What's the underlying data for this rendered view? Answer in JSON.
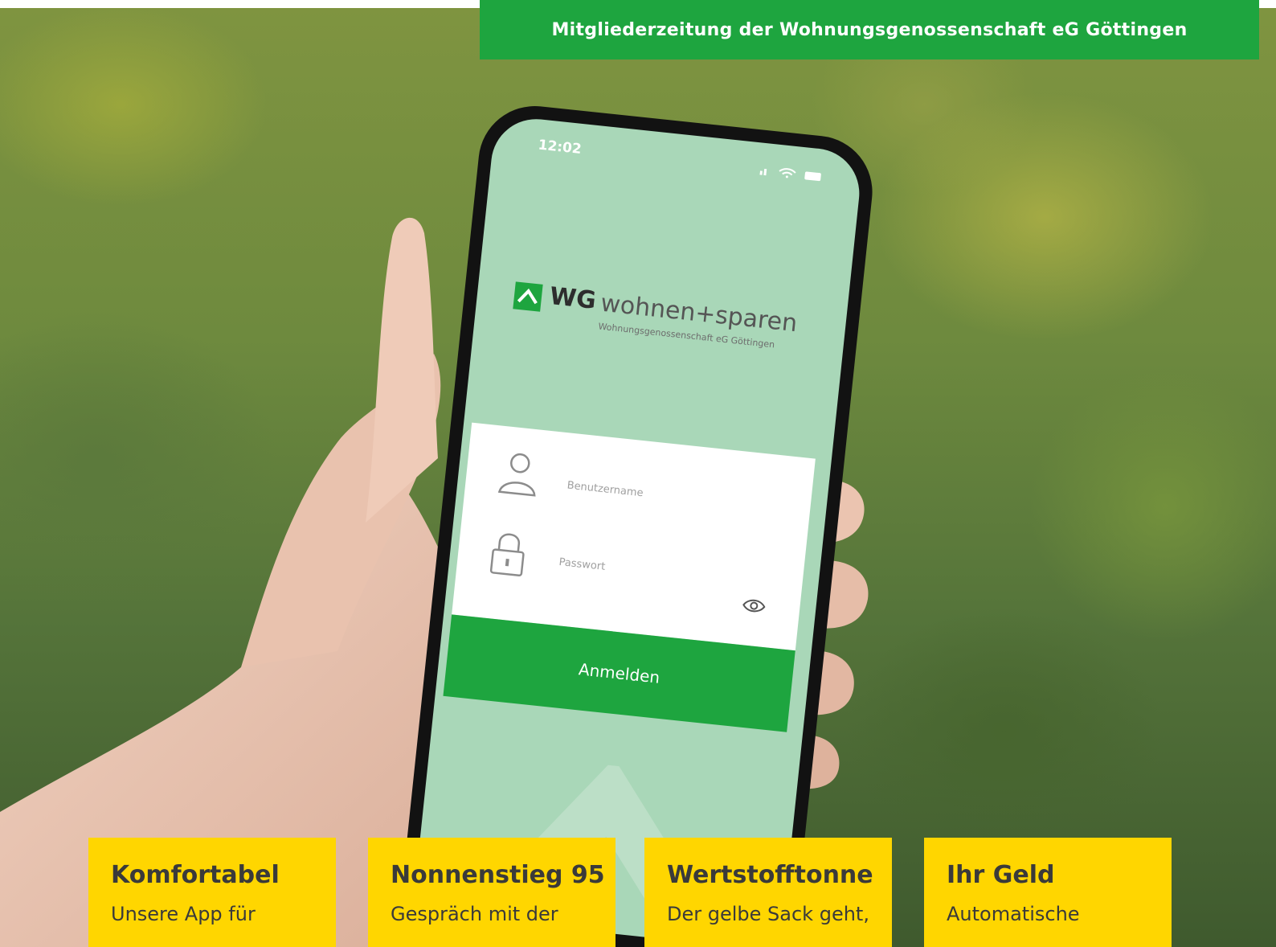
{
  "header": {
    "title": "Mitgliederzeitung der Wohnungsgenossenschaft eG Göttingen"
  },
  "phone": {
    "time": "12:02",
    "logo": {
      "wg": "WG",
      "wordmark": "wohnen+sparen",
      "subline": "Wohnungsgenossenschaft eG Göttingen"
    },
    "login": {
      "username_placeholder": "Benutzername",
      "password_placeholder": "Passwort",
      "button_label": "Anmelden"
    }
  },
  "teasers": [
    {
      "title": "Komfortabel",
      "text": "Unsere App für"
    },
    {
      "title": "Nonnenstieg 95",
      "text": "Gespräch mit der"
    },
    {
      "title": "Wertstofftonne",
      "text": "Der gelbe Sack geht,"
    },
    {
      "title": "Ihr Geld",
      "text": "Automatische"
    }
  ],
  "colors": {
    "brand_green": "#1ea53f",
    "screen_mint": "#a9d7b8",
    "teaser_yellow": "#ffd600",
    "text_dark": "#3a3a3a"
  },
  "icons": [
    "user-icon",
    "lock-icon",
    "eye-icon",
    "signal-icon",
    "wifi-icon",
    "battery-icon",
    "logo-roof-icon"
  ]
}
